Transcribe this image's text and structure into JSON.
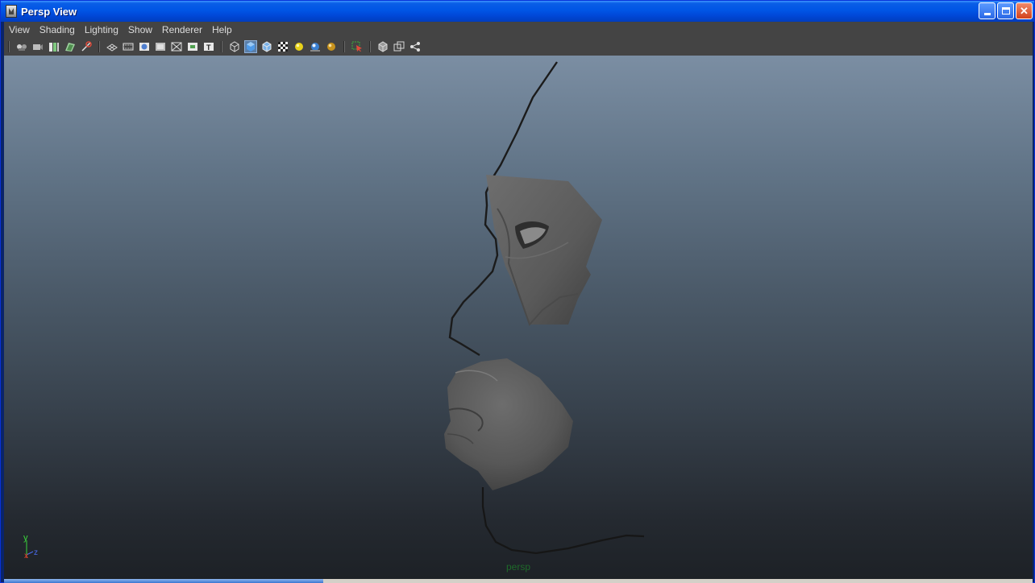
{
  "window": {
    "title": "Persp View"
  },
  "menubar": {
    "items": [
      "View",
      "Shading",
      "Lighting",
      "Show",
      "Renderer",
      "Help"
    ]
  },
  "toolbar": {
    "groups": [
      [
        "select-camera-icon",
        "camera-attributes-icon",
        "bookmarks-icon",
        "image-plane-icon",
        "2d-pan-zoom-icon"
      ],
      [
        "grid-icon",
        "film-gate-icon",
        "resolution-gate-icon",
        "gate-mask-icon",
        "field-chart-icon",
        "safe-action-icon",
        "safe-title-icon"
      ],
      [
        "wireframe-icon",
        "smooth-shade-all-icon",
        "wireframe-on-shaded-icon",
        "textured-icon",
        "use-default-lighting-icon",
        "use-all-lights-icon",
        "shadows-icon"
      ],
      [
        "xray-joints-icon"
      ],
      [
        "isolate-select-icon",
        "xray-icon",
        "component-icon"
      ]
    ]
  },
  "viewport": {
    "camera_label": "persp",
    "axis": {
      "y": "y",
      "x": "x",
      "z": "z"
    },
    "colors": {
      "axis_x": "#e0432a",
      "axis_y": "#3bd43b",
      "axis_z": "#4a6cf0",
      "camera_label": "#1e6a2a"
    }
  },
  "status": {
    "progress_fraction": 0.31
  }
}
